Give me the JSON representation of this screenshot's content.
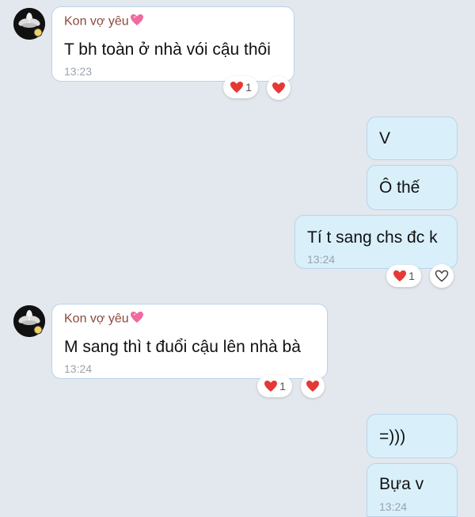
{
  "colors": {
    "background": "#e3e8ee",
    "incoming_bubble": "#ffffff",
    "outgoing_bubble": "#d9f0fb",
    "sender_name": "#8b4a3c",
    "reaction_heart": "#e53935"
  },
  "messages": [
    {
      "type": "incoming",
      "sender": "Kon vợ yêu",
      "text": "T bh toàn ở nhà vói cậu thôi",
      "time": "13:23",
      "reaction_count": "1"
    },
    {
      "type": "outgoing",
      "text": "V"
    },
    {
      "type": "outgoing",
      "text": "Ô thế"
    },
    {
      "type": "outgoing",
      "text": "Tí t sang chs đc k",
      "time": "13:24",
      "reaction_count": "1"
    },
    {
      "type": "incoming",
      "sender": "Kon vợ yêu",
      "text": "M sang thì t đuổi cậu lên nhà bà",
      "time": "13:24",
      "reaction_count": "1"
    },
    {
      "type": "outgoing",
      "text": "=)))"
    },
    {
      "type": "outgoing",
      "text": "Bựa v",
      "time": "13:24"
    }
  ],
  "icons": {
    "avatar": "white-flower-avatar",
    "sender_badge": "pink-heart-icon",
    "reaction": "red-heart-icon",
    "react_button_outline": "heart-outline-icon"
  }
}
